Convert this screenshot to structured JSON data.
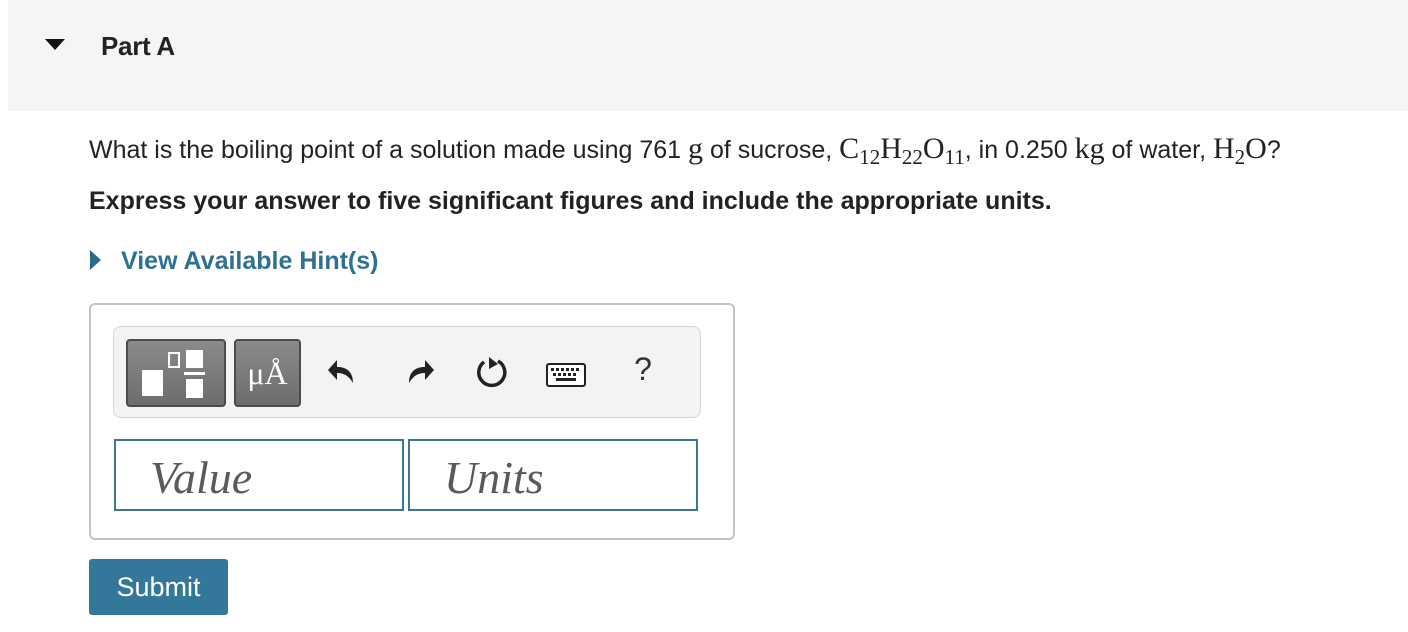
{
  "part": {
    "title": "Part A",
    "icon": "caret-down-icon"
  },
  "question": {
    "text_before": "What is the boiling point of a solution made using 761 ",
    "mass_unit": "g",
    "text_mid1": " of sucrose, ",
    "formula_sucrose": [
      {
        "symbol": "C",
        "sub": "12"
      },
      {
        "symbol": "H",
        "sub": "22"
      },
      {
        "symbol": "O",
        "sub": "11"
      }
    ],
    "text_mid2": ", in 0.250 ",
    "water_unit": "kg",
    "text_mid3": " of water, ",
    "formula_water": [
      {
        "symbol": "H",
        "sub": "2"
      },
      {
        "symbol": "O",
        "sub": ""
      }
    ],
    "text_end": "?"
  },
  "instruction": "Express your answer to five significant figures and include the appropriate units.",
  "hints": {
    "label": "View Available Hint(s)",
    "icon": "caret-right-icon"
  },
  "toolbar": {
    "templates_icon": "templates-icon",
    "symbols_label": "μÅ",
    "undo_icon": "undo-icon",
    "redo_icon": "redo-icon",
    "reset_icon": "reset-icon",
    "keyboard_icon": "keyboard-icon",
    "help_label": "?"
  },
  "fields": {
    "value_placeholder": "Value",
    "units_placeholder": "Units"
  },
  "submit_label": "Submit",
  "colors": {
    "header_bg": "#f5f5f5",
    "link": "#2d7193",
    "button": "#33789a",
    "field_border": "#3b7793",
    "toolbar_button": "#6d6d6d"
  }
}
